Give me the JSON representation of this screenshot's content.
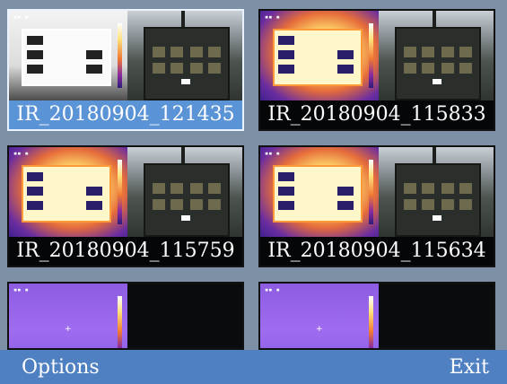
{
  "files": [
    {
      "name": "IR_20180904_121435",
      "selected": true,
      "palette": "white"
    },
    {
      "name": "IR_20180904_115833",
      "selected": false,
      "palette": "thermal"
    },
    {
      "name": "IR_20180904_115759",
      "selected": false,
      "palette": "thermal"
    },
    {
      "name": "IR_20180904_115634",
      "selected": false,
      "palette": "thermal"
    },
    {
      "name": "",
      "selected": false,
      "palette": "violet"
    },
    {
      "name": "",
      "selected": false,
      "palette": "violet"
    }
  ],
  "softkeys": {
    "left": "Options",
    "right": "Exit"
  },
  "colors": {
    "selection": "#5a93d6",
    "softkey_bar": "#4f80c2",
    "background": "#7e90a6"
  }
}
